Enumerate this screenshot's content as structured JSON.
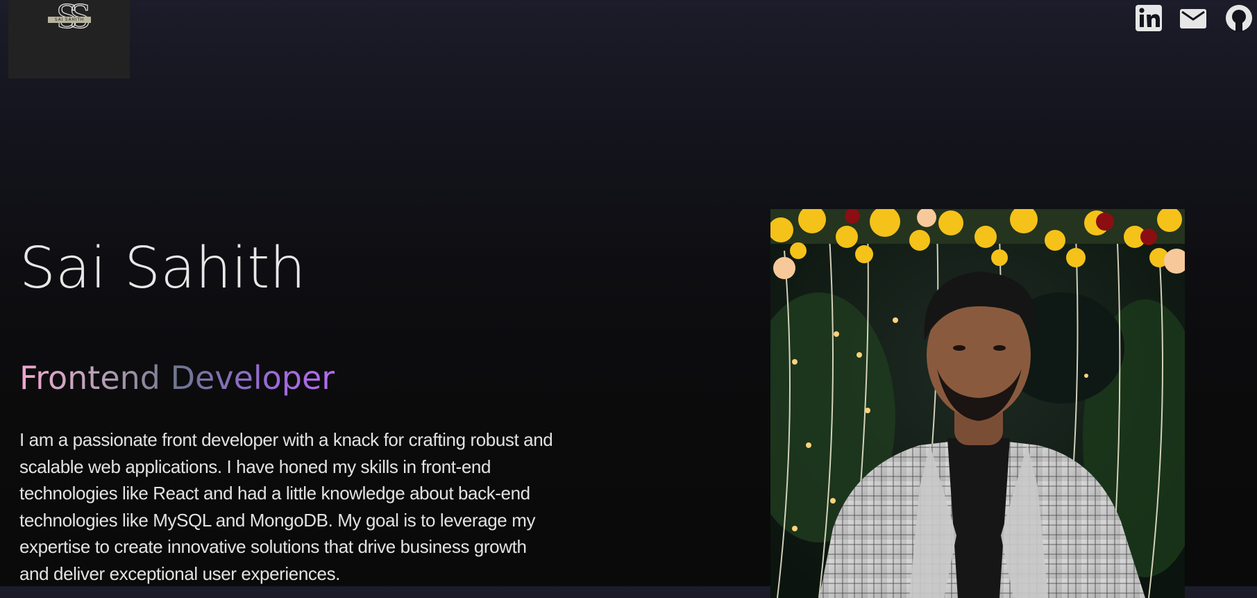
{
  "header": {
    "logo": {
      "monogram": "SS",
      "wordmark": "SAI SAHITH"
    },
    "social_links": [
      {
        "icon": "linkedin-icon"
      },
      {
        "icon": "mail-icon"
      },
      {
        "icon": "github-icon"
      }
    ]
  },
  "hero": {
    "name": "Sai Sahith",
    "role": "Frontend Developer",
    "bio": "I am a passionate front developer with a knack for crafting robust and scalable web applications. I have honed my skills in front-end technologies like React and had a little knowledge about back-end technologies like MySQL and MongoDB. My goal is to leverage my expertise to create innovative solutions that drive business growth and deliver exceptional user experiences."
  },
  "profile_photo": {
    "description": "portrait"
  },
  "colors": {
    "background_top": "#1c1c2a",
    "background_bottom": "#0a0a0a",
    "role_gradient_start": "#f0a7d0",
    "role_gradient_end": "#b36cf0",
    "logo_box": "#222222"
  }
}
